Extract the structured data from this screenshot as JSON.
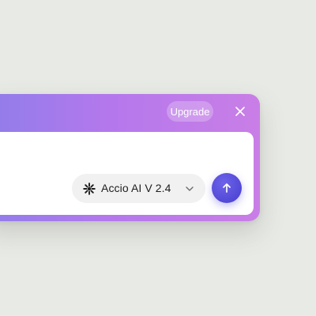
{
  "header": {
    "upgrade_label": "Upgrade",
    "close_icon": "close-icon"
  },
  "input": {
    "value": "",
    "placeholder": ""
  },
  "model_selector": {
    "selected": "Accio AI V 2.4",
    "icon": "sparkle-burst-icon",
    "chevron": "chevron-down-icon"
  },
  "send": {
    "icon": "arrow-up-icon"
  },
  "colors": {
    "gradient_start": "#8f7dea",
    "gradient_end": "#c97ee6",
    "send_button": "#5148d6",
    "background": "#e8eae5"
  }
}
